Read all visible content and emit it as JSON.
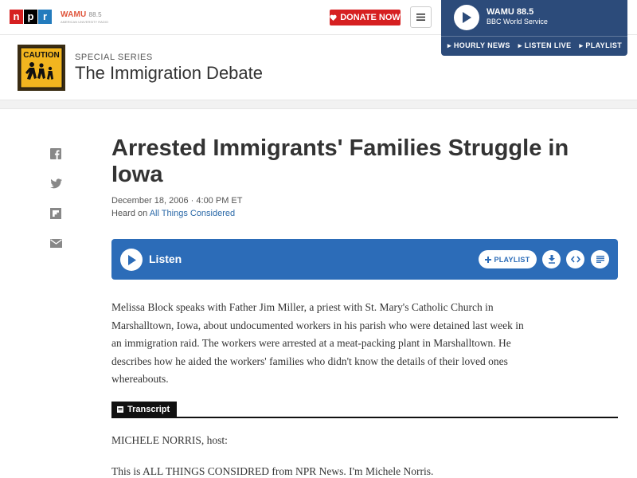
{
  "header": {
    "logo_letters": [
      "n",
      "p",
      "r"
    ],
    "station_logo": "WAMU",
    "station_freq": "88.5",
    "station_tagline": "AMERICAN UNIVERSITY RADIO",
    "donate_label": "DONATE NOW",
    "donate_icon": "heart-icon",
    "menu_icon": "hamburger-icon"
  },
  "player": {
    "station": "WAMU 88.5",
    "program": "BBC World Service",
    "links": [
      "HOURLY NEWS",
      "LISTEN LIVE",
      "PLAYLIST"
    ],
    "bg_color": "#2c4b7a"
  },
  "series": {
    "kicker": "SPECIAL SERIES",
    "title": "The Immigration Debate",
    "image_sign_text": "CAUTION"
  },
  "social": [
    {
      "name": "facebook-icon"
    },
    {
      "name": "twitter-icon"
    },
    {
      "name": "flipboard-icon"
    },
    {
      "name": "email-icon"
    }
  ],
  "article": {
    "title": "Arrested Immigrants' Families Struggle in Iowa",
    "date": "December 18, 2006 · 4:00 PM ET",
    "heard_prefix": "Heard on",
    "heard_show": "All Things Considered",
    "teaser": "Melissa Block speaks with Father Jim Miller, a priest with St. Mary's Catholic Church in Marshalltown, Iowa, about undocumented workers in his parish who were detained last week in an immigration raid. The workers were arrested at a meat-packing plant in Marshalltown. He describes how he aided the workers' families who didn't know the details of their loved ones whereabouts."
  },
  "listen": {
    "label": "Listen",
    "playlist_label": "PLAYLIST",
    "accent_color": "#2c6cb8",
    "icons": [
      "download-icon",
      "embed-icon",
      "transcript-icon"
    ]
  },
  "transcript": {
    "tab_label": "Transcript",
    "line1": "MICHELE NORRIS, host:",
    "line2": "This is ALL THINGS CONSIDRED from NPR News. I'm Michele Norris."
  }
}
